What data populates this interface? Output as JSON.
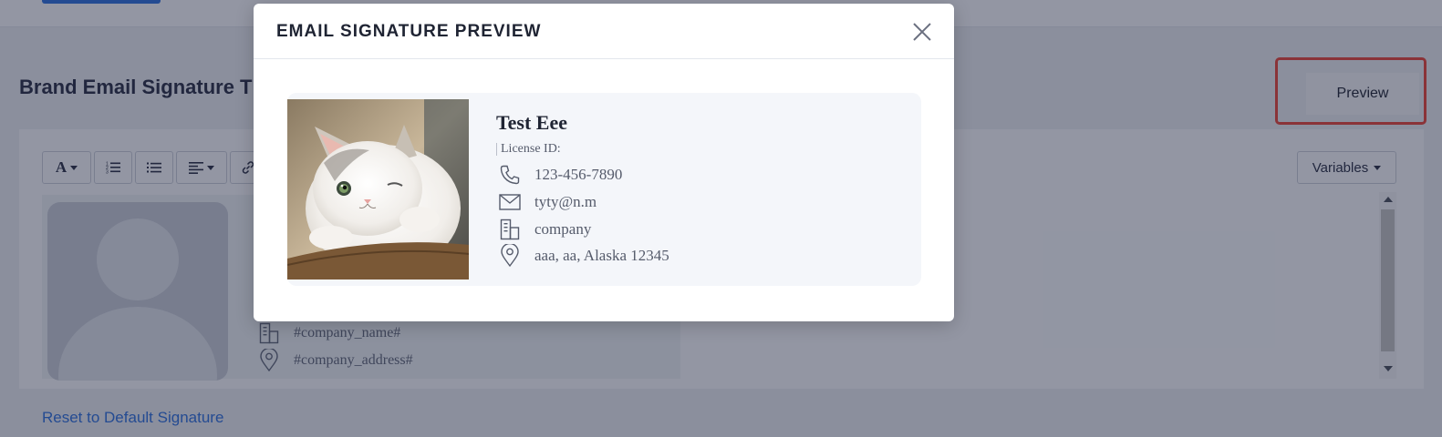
{
  "page": {
    "section_title": "Brand Email Signature T",
    "preview_label": "Preview",
    "variables_label": "Variables",
    "reset_label": "Reset to Default Signature",
    "editor_lines": [
      {
        "icon": "building-icon",
        "text": "#company_name#"
      },
      {
        "icon": "location-pin-icon",
        "text": "#company_address#"
      }
    ],
    "toolbar": {
      "font_label": "A"
    }
  },
  "modal": {
    "title": "EMAIL SIGNATURE PREVIEW",
    "close_icon": "close-icon",
    "signature": {
      "name": "Test Eee",
      "license": "License ID:",
      "phone": "123-456-7890",
      "email": "tyty@n.m",
      "company": "company",
      "address": "aaa, aa, Alaska 12345"
    }
  },
  "colors": {
    "accent": "#2f6fdc",
    "highlight": "#e8443a",
    "overlay": "#181f38"
  }
}
